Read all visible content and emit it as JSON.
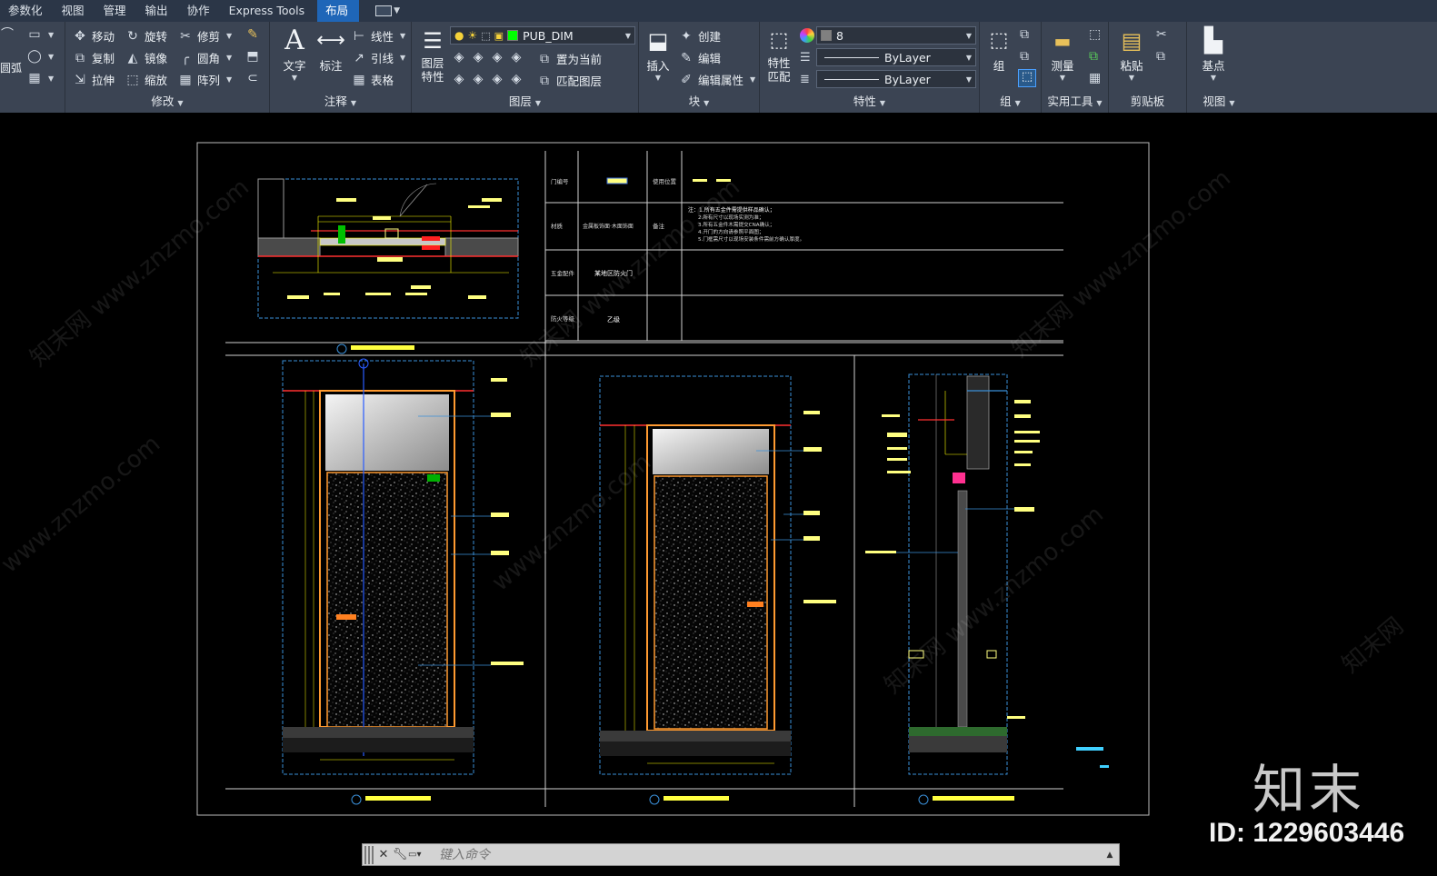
{
  "menu": {
    "tabs": [
      "参数化",
      "视图",
      "管理",
      "输出",
      "协作",
      "Express Tools",
      "布局"
    ],
    "active_tab": "布局"
  },
  "ribbon": {
    "draw_cut_label": "圆弧",
    "modify": {
      "title": "修改",
      "move": "移动",
      "rotate": "旋转",
      "trim": "修剪",
      "copy": "复制",
      "mirror": "镜像",
      "fillet": "圆角",
      "stretch": "拉伸",
      "scale": "缩放",
      "array": "阵列"
    },
    "annotation": {
      "title": "注释",
      "text": "文字",
      "dimension": "标注",
      "linear": "线性",
      "leader": "引线",
      "table": "表格"
    },
    "layers": {
      "title": "图层",
      "layer_properties": "图层\n特性",
      "current_layer": "PUB_DIM",
      "current_layer_color": "#00ff00",
      "set_current": "置为当前",
      "match_layer": "匹配图层"
    },
    "block": {
      "title": "块",
      "insert": "插入",
      "create": "创建",
      "edit": "编辑",
      "edit_attributes": "编辑属性"
    },
    "properties": {
      "title": "特性",
      "match_properties": "特性\n匹配",
      "color_value": "8",
      "linetype_value": "ByLayer",
      "lineweight_value": "ByLayer"
    },
    "groups": {
      "title": "组",
      "group": "组"
    },
    "utilities": {
      "title": "实用工具",
      "measure": "测量"
    },
    "clipboard": {
      "title": "剪贴板",
      "paste": "粘贴"
    },
    "view": {
      "title": "视图",
      "base_point": "基点"
    }
  },
  "drawing": {
    "table": {
      "row1_label_left": "门编号",
      "row1_label_right": "使用位置",
      "row2_label_left": "材质",
      "row2_value": "金属板饰面·木面饰面",
      "row2_label_right": "备注",
      "notes_title": "注：1.所有五金件需提供样品确认；",
      "notes": [
        "2.所有尺寸以现场实测为准；",
        "3.所有五金件木需提交CNA确认；",
        "4.开门的方向请参照平面图；",
        "5.门框需尺寸以现场安装条件需前方确认厚度。"
      ],
      "row3_label": "五金配件",
      "row3_value": "某地区防火门",
      "row4_label": "防火等级",
      "row4_value": "乙级"
    }
  },
  "command_line": {
    "placeholder": "键入命令"
  },
  "watermark": {
    "site": "www.znzmo.com",
    "cn": "知末网",
    "logo": "知末",
    "id_text": "ID: 1229603446"
  }
}
